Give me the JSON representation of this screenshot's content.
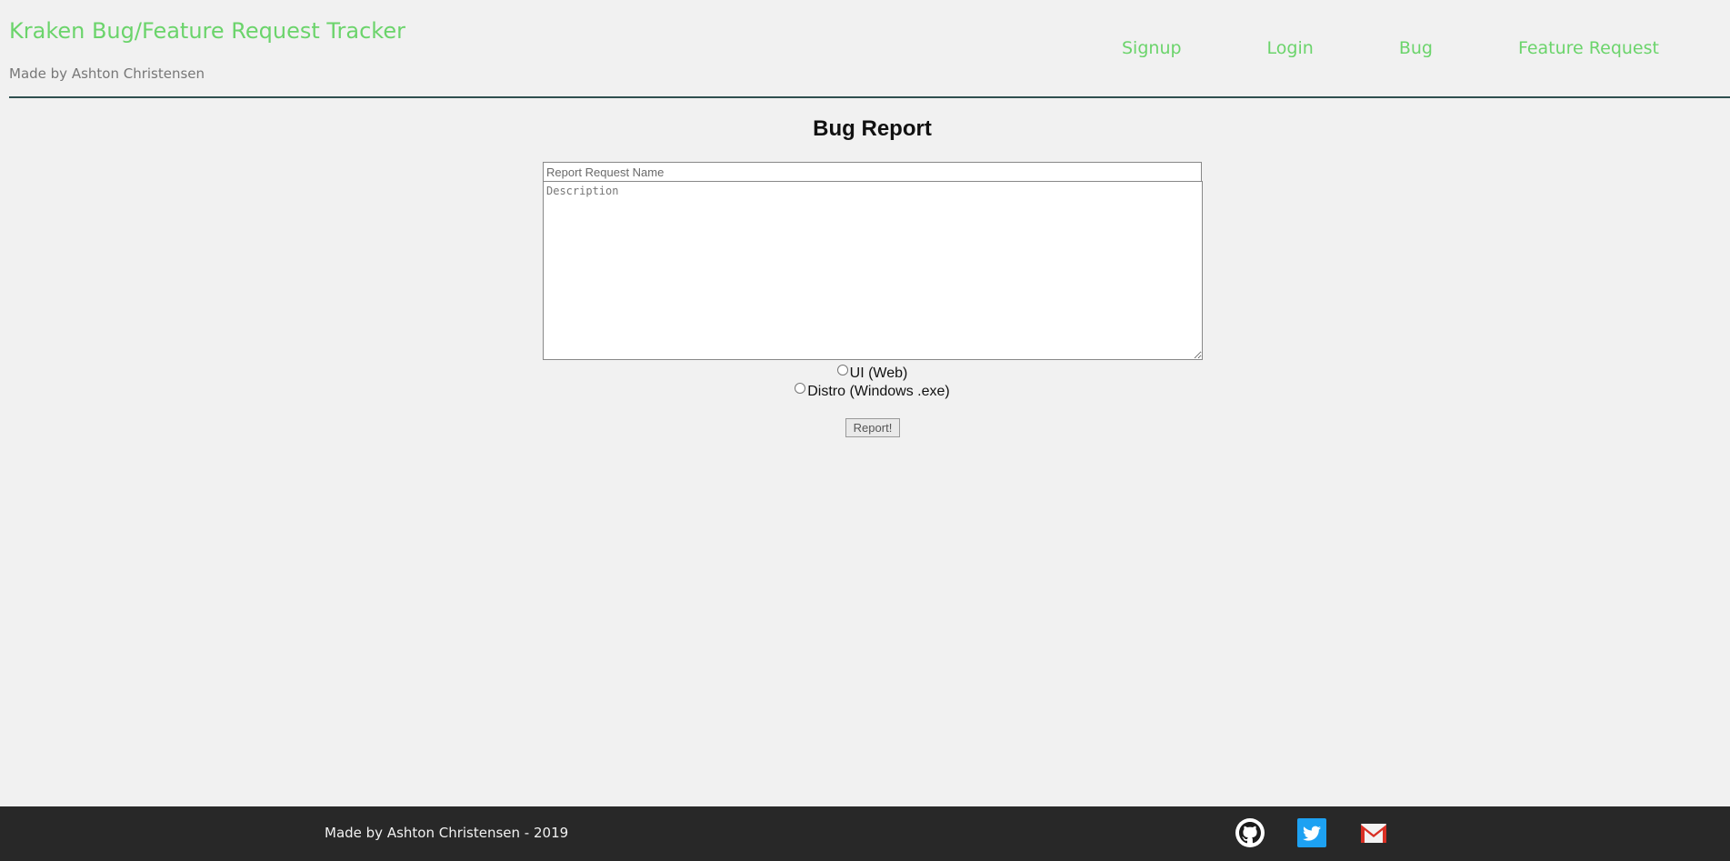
{
  "header": {
    "title": "Kraken Bug/Feature Request Tracker",
    "subtitle": "Made by Ashton Christensen",
    "nav": [
      {
        "label": "Signup"
      },
      {
        "label": "Login"
      },
      {
        "label": "Bug"
      },
      {
        "label": "Feature Request"
      }
    ]
  },
  "form": {
    "title": "Bug Report",
    "name_placeholder": "Report Request Name",
    "description_placeholder": "Description",
    "radio_options": [
      {
        "label": "UI (Web)"
      },
      {
        "label": "Distro (Windows .exe)"
      }
    ],
    "submit_label": "Report!"
  },
  "footer": {
    "text": "Made by Ashton Christensen - 2019",
    "social_icons": [
      "github-icon",
      "twitter-icon",
      "gmail-icon"
    ]
  },
  "colors": {
    "accent_green": "#6bd46b",
    "footer_bg": "#282828",
    "page_bg": "#f1f1f1",
    "twitter_blue": "#1da1f2",
    "gmail_red": "#d93025"
  }
}
